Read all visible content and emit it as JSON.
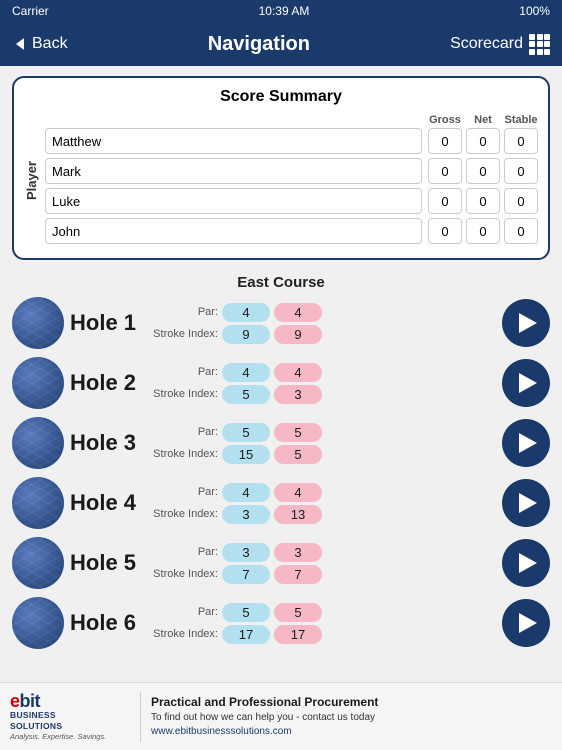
{
  "statusBar": {
    "carrier": "Carrier",
    "time": "10:39 AM",
    "signal": "100%"
  },
  "header": {
    "backLabel": "Back",
    "title": "Navigation",
    "scorecardLabel": "Scorecard"
  },
  "scoreSummary": {
    "title": "Score Summary",
    "playerLabel": "Player",
    "columnLabels": [
      "Gross",
      "Net",
      "Stable"
    ],
    "players": [
      {
        "name": "Matthew",
        "scores": [
          "0",
          "0",
          "0"
        ]
      },
      {
        "name": "Mark",
        "scores": [
          "0",
          "0",
          "0"
        ]
      },
      {
        "name": "Luke",
        "scores": [
          "0",
          "0",
          "0"
        ]
      },
      {
        "name": "John",
        "scores": [
          "0",
          "0",
          "0"
        ]
      }
    ]
  },
  "course": {
    "name": "East Course",
    "holes": [
      {
        "label": "Hole 1",
        "par_blue": "4",
        "par_pink": "4",
        "si_blue": "9",
        "si_pink": "9"
      },
      {
        "label": "Hole 2",
        "par_blue": "4",
        "par_pink": "4",
        "si_blue": "5",
        "si_pink": "3"
      },
      {
        "label": "Hole 3",
        "par_blue": "5",
        "par_pink": "5",
        "si_blue": "15",
        "si_pink": "5"
      },
      {
        "label": "Hole 4",
        "par_blue": "4",
        "par_pink": "4",
        "si_blue": "3",
        "si_pink": "13"
      },
      {
        "label": "Hole 5",
        "par_blue": "3",
        "par_pink": "3",
        "si_blue": "7",
        "si_pink": "7"
      },
      {
        "label": "Hole 6",
        "par_blue": "5",
        "par_pink": "5",
        "si_blue": "17",
        "si_pink": "17"
      }
    ],
    "parLabel": "Par:",
    "strokeIndexLabel": "Stroke Index:"
  },
  "ad": {
    "logoMain": "ebit",
    "logoHighlight": "e",
    "logoSub": "BUSINESS\nSOLUTIONS",
    "tagline": "Analysis. Expertise. Savings.",
    "headline": "Practical and Professional Procurement",
    "subtext": "To find out how we can help you - contact us today",
    "url": "www.ebitbusinesssolutions.com"
  }
}
